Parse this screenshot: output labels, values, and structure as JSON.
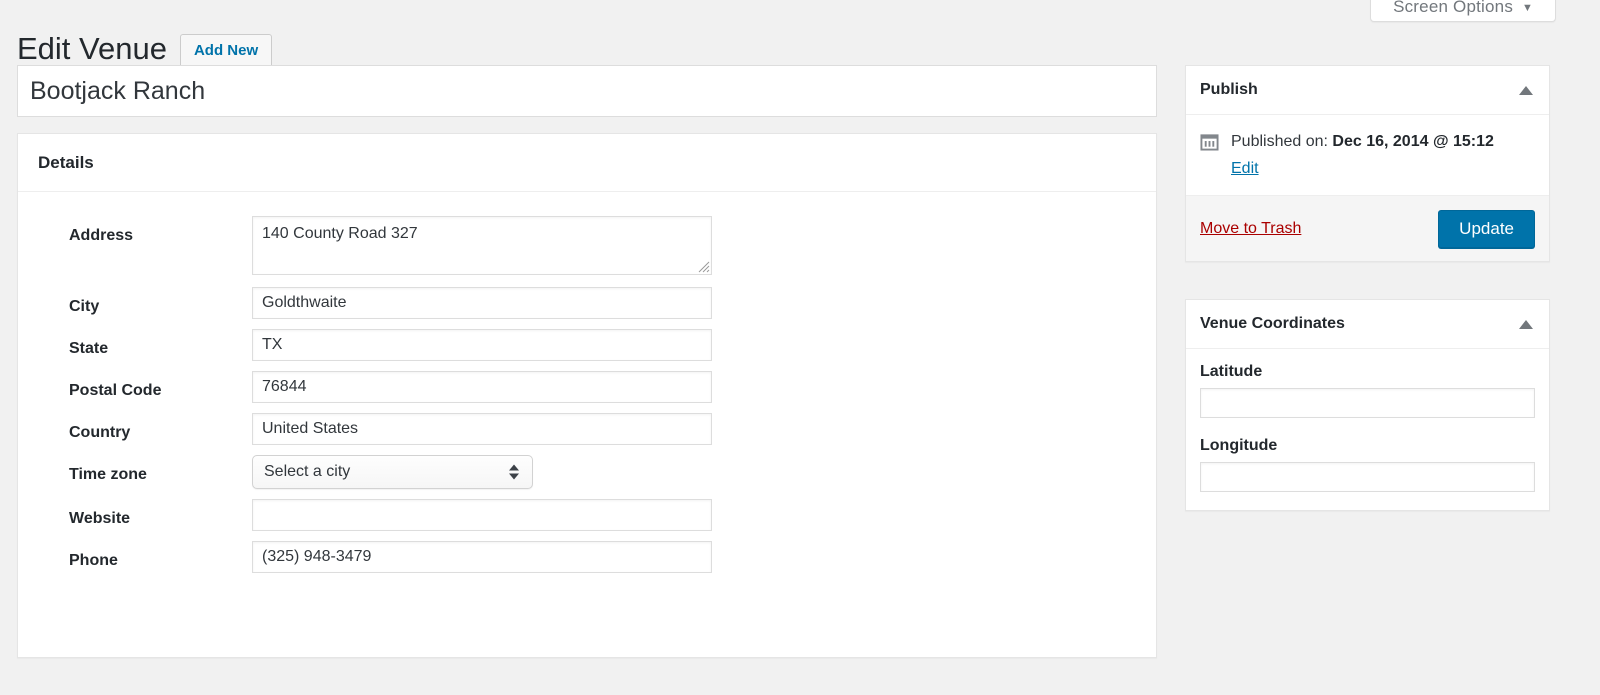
{
  "screen_options": {
    "label": "Screen Options",
    "caret": "▼"
  },
  "header": {
    "page_title": "Edit Venue",
    "add_new_label": "Add New"
  },
  "post_title": {
    "value": "Bootjack Ranch",
    "placeholder": "Enter title here"
  },
  "details": {
    "heading": "Details",
    "fields": [
      {
        "label": "Address",
        "type": "textarea",
        "value": "140 County Road 327",
        "placeholder": ""
      },
      {
        "label": "City",
        "type": "text",
        "value": "Goldthwaite",
        "placeholder": ""
      },
      {
        "label": "State",
        "type": "text",
        "value": "TX",
        "placeholder": ""
      },
      {
        "label": "Postal Code",
        "type": "text",
        "value": "76844",
        "placeholder": ""
      },
      {
        "label": "Country",
        "type": "text",
        "value": "United States",
        "placeholder": ""
      },
      {
        "label": "Time zone",
        "type": "select",
        "value": "Select a city",
        "placeholder": ""
      },
      {
        "label": "Website",
        "type": "text",
        "value": "",
        "placeholder": ""
      },
      {
        "label": "Phone",
        "type": "text",
        "value": "(325) 948-3479",
        "placeholder": ""
      }
    ]
  },
  "publish": {
    "heading": "Publish",
    "published_prefix": "Published on:",
    "published_date": "Dec 16, 2014 @ 15:12",
    "edit_label": "Edit",
    "trash_label": "Move to Trash",
    "update_label": "Update"
  },
  "coordinates": {
    "heading": "Venue Coordinates",
    "latitude_label": "Latitude",
    "latitude_value": "",
    "longitude_label": "Longitude",
    "longitude_value": ""
  },
  "colors": {
    "accent_blue": "#0073aa",
    "danger_red": "#a00",
    "page_bg": "#f1f1f1",
    "panel_bg": "#ffffff",
    "border": "#e5e5e5"
  }
}
